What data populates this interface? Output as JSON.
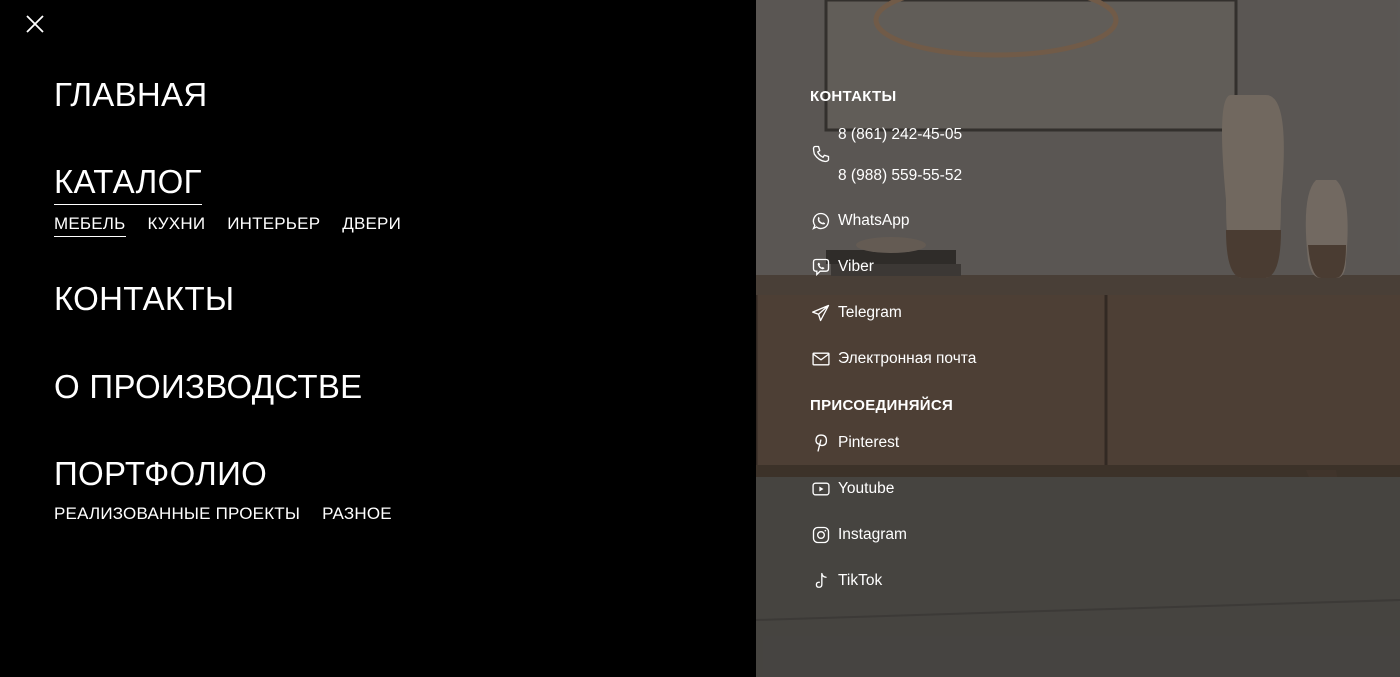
{
  "menu": {
    "close_icon": "close-icon",
    "home": "ГЛАВНАЯ",
    "catalog": "КАТАЛОГ",
    "catalog_sub": [
      "МЕБЕЛЬ",
      "КУХНИ",
      "ИНТЕРЬЕР",
      "ДВЕРИ"
    ],
    "contacts": "КОНТАКТЫ",
    "production": "О ПРОИЗВОДСТВЕ",
    "portfolio": "ПОРТФОЛИО",
    "portfolio_sub": [
      "РЕАЛИЗОВАННЫЕ ПРОЕКТЫ",
      "РАЗНОЕ"
    ]
  },
  "contacts": {
    "title": "КОНТАКТЫ",
    "phone_icon": "phone-icon",
    "phones": [
      "8 (861) 242-45-05",
      "8 (988) 559-55-52"
    ],
    "links": [
      {
        "label": "WhatsApp",
        "icon": "whatsapp-icon"
      },
      {
        "label": "Viber",
        "icon": "viber-icon"
      },
      {
        "label": "Telegram",
        "icon": "telegram-icon"
      },
      {
        "label": "Электронная почта",
        "icon": "email-icon"
      }
    ]
  },
  "join": {
    "title": "ПРИСОЕДИНЯЙСЯ",
    "links": [
      {
        "label": "Pinterest",
        "icon": "pinterest-icon"
      },
      {
        "label": "Youtube",
        "icon": "youtube-icon"
      },
      {
        "label": "Instagram",
        "icon": "instagram-icon"
      },
      {
        "label": "TikTok",
        "icon": "tiktok-icon"
      }
    ]
  },
  "colors": {
    "menu_background": "#000000",
    "text": "#ffffff"
  }
}
